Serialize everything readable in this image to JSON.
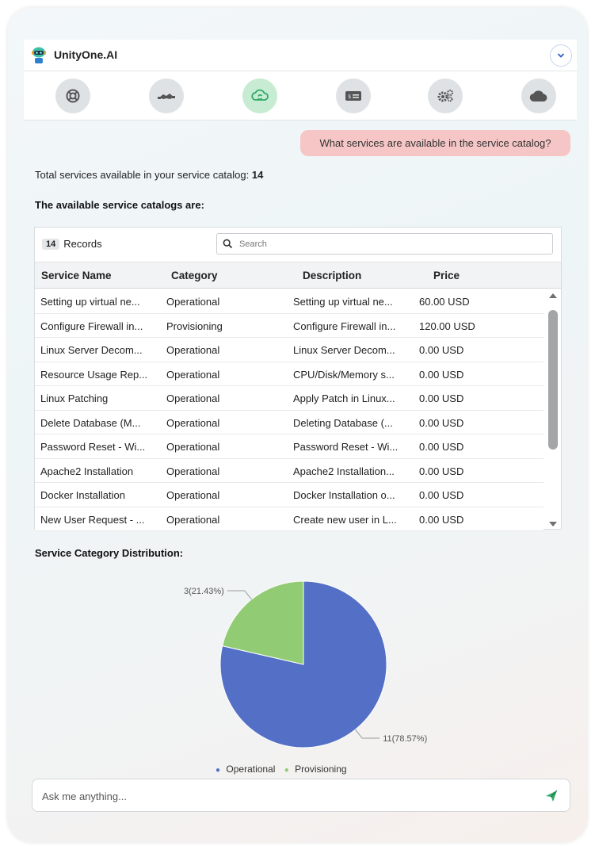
{
  "app": {
    "title": "UnityOne.AI"
  },
  "toolbar": {
    "icons": [
      "helpdesk-icon",
      "handshake-icon",
      "cloud-sync-icon",
      "billing-icon",
      "settings-gears-icon",
      "cloud-icon"
    ],
    "active_index": 2
  },
  "chat": {
    "user_message": "What services are available in the service catalog?",
    "total_label": "Total services available in your service catalog: ",
    "total_value": "14",
    "catalog_heading": "The available service catalogs are:"
  },
  "table": {
    "records_count": "14",
    "records_label": "Records",
    "search_placeholder": "Search",
    "columns": [
      "Service Name",
      "Category",
      "Description",
      "Price"
    ],
    "rows": [
      [
        "Setting up virtual ne...",
        "Operational",
        "Setting up virtual ne...",
        "60.00 USD"
      ],
      [
        "Configure Firewall in...",
        "Provisioning",
        "Configure Firewall in...",
        "120.00 USD"
      ],
      [
        "Linux Server Decom...",
        "Operational",
        "Linux Server Decom...",
        "0.00 USD"
      ],
      [
        "Resource Usage Rep...",
        "Operational",
        "CPU/Disk/Memory s...",
        "0.00 USD"
      ],
      [
        "Linux Patching",
        "Operational",
        "Apply Patch in Linux...",
        "0.00 USD"
      ],
      [
        "Delete Database (M...",
        "Operational",
        "Deleting Database (...",
        "0.00 USD"
      ],
      [
        "Password Reset - Wi...",
        "Operational",
        "Password Reset - Wi...",
        "0.00 USD"
      ],
      [
        "Apache2 Installation",
        "Operational",
        "Apache2 Installation...",
        "0.00 USD"
      ],
      [
        "Docker Installation",
        "Operational",
        "Docker Installation o...",
        "0.00 USD"
      ],
      [
        "New User Request - ...",
        "Operational",
        "Create new user in L...",
        "0.00 USD"
      ]
    ]
  },
  "chart_section": {
    "title": "Service Category Distribution:"
  },
  "chart_data": {
    "type": "pie",
    "categories": [
      "Operational",
      "Provisioning"
    ],
    "values": [
      11,
      3
    ],
    "labels": [
      "11(78.57%)",
      "3(21.43%)"
    ],
    "colors": [
      "#5470c6",
      "#91cc75"
    ],
    "legend_placement": "bottom"
  },
  "composer": {
    "placeholder": "Ask me anything..."
  },
  "colors": {
    "accent_green": "#2fa868",
    "user_bubble": "#f6c6c6",
    "active_tool": "#c7ecd3"
  }
}
